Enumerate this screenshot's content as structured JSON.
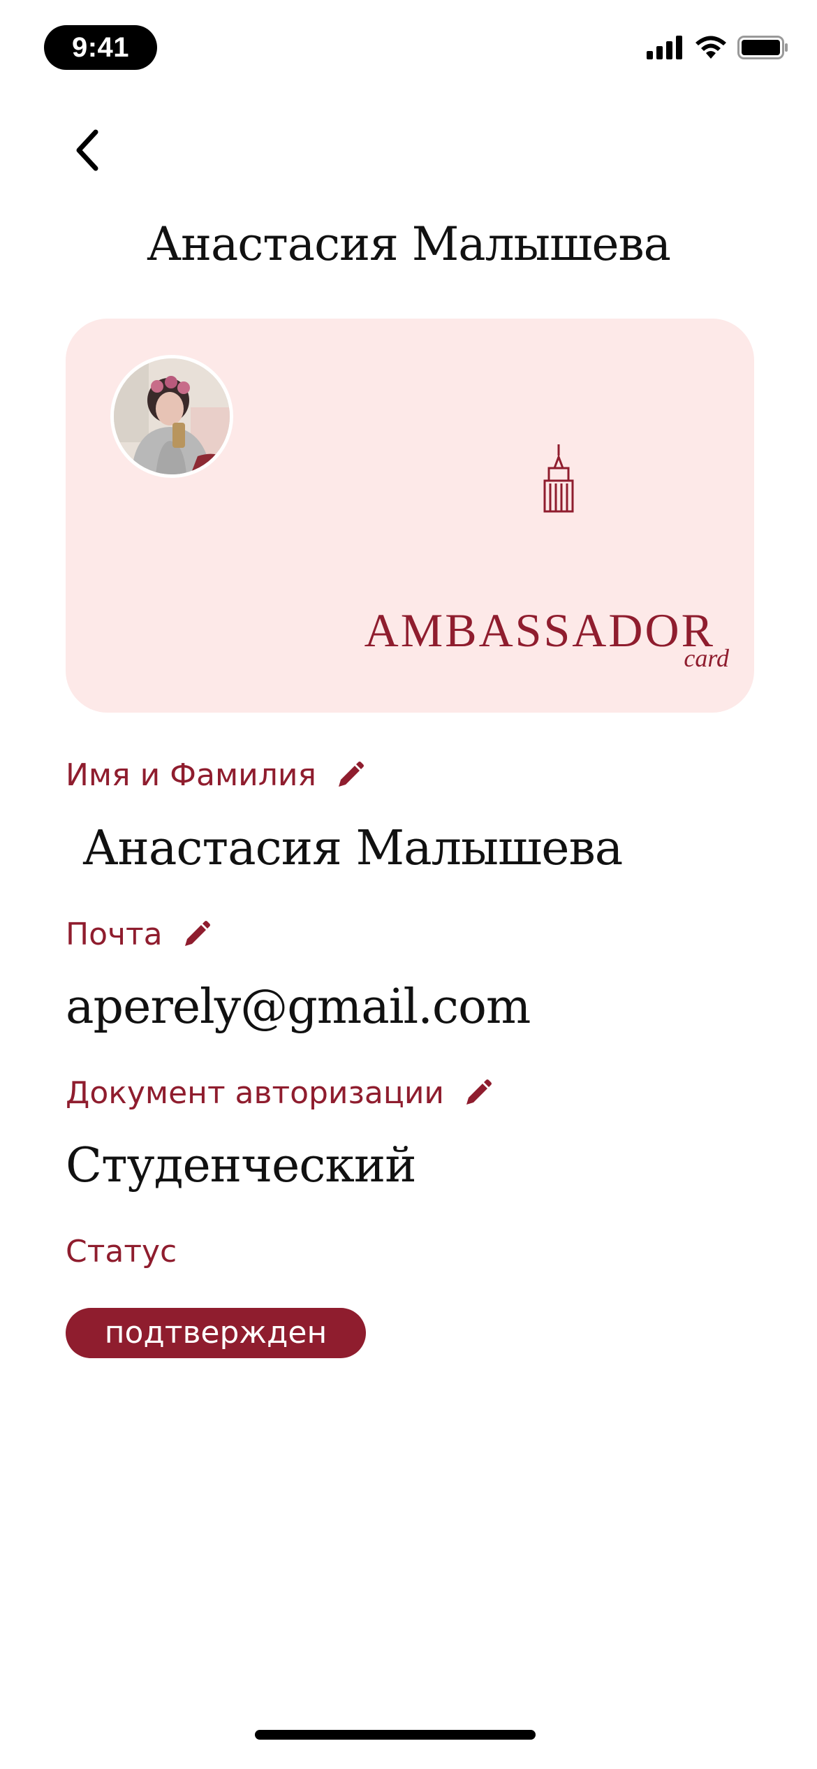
{
  "status_bar": {
    "time": "9:41"
  },
  "header": {
    "title": "Анастасия Малышева"
  },
  "card": {
    "brand_name": "AMBASSADOR",
    "brand_sub": "card",
    "brand_color": "#8f1d2e",
    "background_color": "#fde9e8"
  },
  "fields": {
    "name": {
      "label": "Имя и Фамилия",
      "value": "Анастасия Малышева"
    },
    "email": {
      "label": "Почта",
      "value": "aperely@gmail.com"
    },
    "document": {
      "label": "Документ авторизации",
      "value": "Студенческий"
    },
    "status": {
      "label": "Статус",
      "value": "подтвержден"
    }
  },
  "icons": {
    "back": "chevron-left-icon",
    "edit": "pencil-icon",
    "signal": "cellular-signal-icon",
    "wifi": "wifi-icon",
    "battery": "battery-icon"
  },
  "colors": {
    "accent": "#8f1d2e",
    "text": "#111111"
  }
}
